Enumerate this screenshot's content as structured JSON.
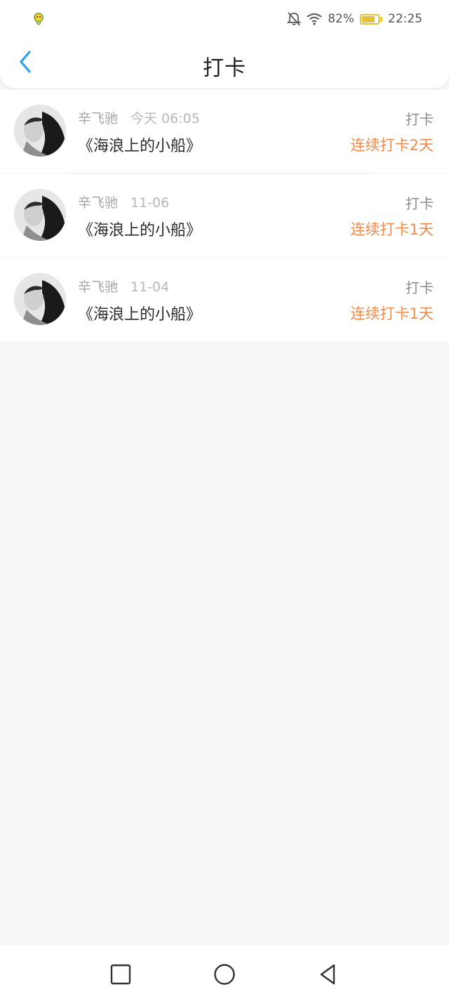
{
  "status_bar": {
    "battery_percent": "82%",
    "battery_level": 0.82,
    "time": "22:25",
    "icons": [
      "app-notification-icon",
      "bell-muted-icon",
      "wifi-icon",
      "battery-icon"
    ]
  },
  "header": {
    "title": "打卡",
    "back_icon": "chevron-left-icon",
    "accent_color": "#2aa1e8"
  },
  "checkins": [
    {
      "user": "辛飞驰",
      "date": "今天 06:05",
      "book": "《海浪上的小船》",
      "type": "打卡",
      "streak": "连续打卡2天"
    },
    {
      "user": "辛飞驰",
      "date": "11-06",
      "book": "《海浪上的小船》",
      "type": "打卡",
      "streak": "连续打卡1天"
    },
    {
      "user": "辛飞驰",
      "date": "11-04",
      "book": "《海浪上的小船》",
      "type": "打卡",
      "streak": "连续打卡1天"
    }
  ],
  "colors": {
    "streak": "#f08a4b",
    "background": "#f8f6f7"
  },
  "system_nav": {
    "icons": [
      "recent-apps-icon",
      "home-icon",
      "back-icon"
    ]
  }
}
